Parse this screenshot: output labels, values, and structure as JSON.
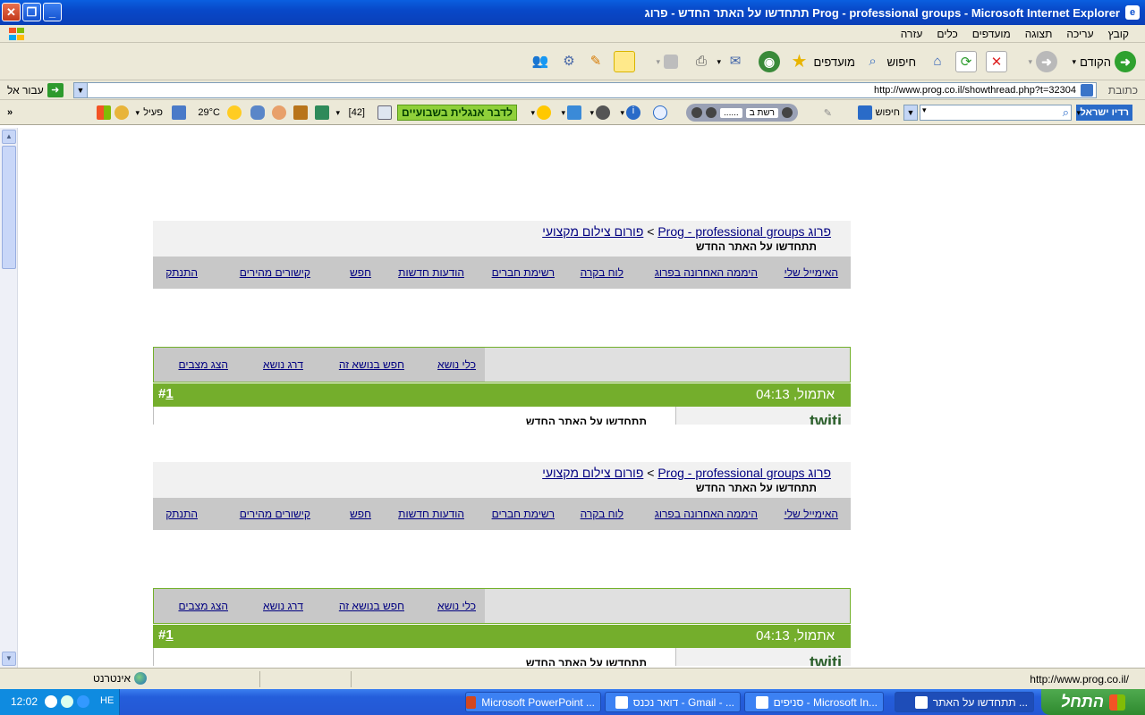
{
  "window": {
    "title": "תתחדשו על האתר החדש - פרוג Prog - professional groups - Microsoft Internet Explorer"
  },
  "menu": [
    "קובץ",
    "עריכה",
    "תצוגה",
    "מועדפים",
    "כלים",
    "עזרה"
  ],
  "toolbar": {
    "back_label": "הקודם",
    "search_label": "חיפוש",
    "favorites_label": "מועדפים"
  },
  "address": {
    "label": "כתובת",
    "url": "http://www.prog.co.il/showthread.php?t=32304",
    "go_label": "עבור אל"
  },
  "links_bar": {
    "logo": "רדיו ישראל",
    "search_label": "חיפוש",
    "player_label": "רשת ב",
    "player_dots": "......",
    "promo": "לדבר אנגלית בשבועיים",
    "mail_count": "[42]",
    "temp": "29°C",
    "active_label": "פעיל",
    "more": "»"
  },
  "page": {
    "blocks": [
      {
        "crumb_link": "פרוג Prog - professional groups",
        "crumb_sep": ">",
        "forum_link": "פורום צילום מקצועי",
        "thread_title": "תתחדשו על האתר החדש",
        "nav": [
          "האימייל שלי",
          "היממה האחרונה בפרוג",
          "לוח בקרה",
          "רשימת חברים",
          "הודעות חדשות",
          "חפש",
          "קישורים מהירים",
          "התנתק"
        ],
        "tools": [
          "כלי נושא",
          "חפש בנושא זה",
          "דרג נושא",
          "הצג מצבים"
        ],
        "date": "אתמול, 04:13",
        "post_hash": "#",
        "post_num": "1",
        "user": "twiti",
        "post_title": "תתחדשו על האתר החדש"
      },
      {
        "crumb_link": "פרוג Prog - professional groups",
        "crumb_sep": ">",
        "forum_link": "פורום צילום מקצועי",
        "thread_title": "תתחדשו על האתר החדש",
        "nav": [
          "האימייל שלי",
          "היממה האחרונה בפרוג",
          "לוח בקרה",
          "רשימת חברים",
          "הודעות חדשות",
          "חפש",
          "קישורים מהירים",
          "התנתק"
        ],
        "tools": [
          "כלי נושא",
          "חפש בנושא זה",
          "דרג נושא",
          "הצג מצבים"
        ],
        "date": "אתמול, 04:13",
        "post_hash": "#",
        "post_num": "1",
        "user": "twiti",
        "post_title": "תתחדשו על האתר החדש"
      }
    ]
  },
  "status": {
    "url": "http://www.prog.co.il/",
    "zone": "אינטרנט"
  },
  "taskbar": {
    "start": "התחל",
    "tasks": [
      "תתחדשו על האתר ...",
      "סניפים - Microsoft In...",
      "דואר נכנס - Gmail - ...",
      "Microsoft PowerPoint ..."
    ],
    "clock": "12:02",
    "lang": "HE"
  },
  "colors": {
    "green_bar": "#74ae2c",
    "link": "#000080",
    "nav_bg": "#c8c8c8"
  }
}
